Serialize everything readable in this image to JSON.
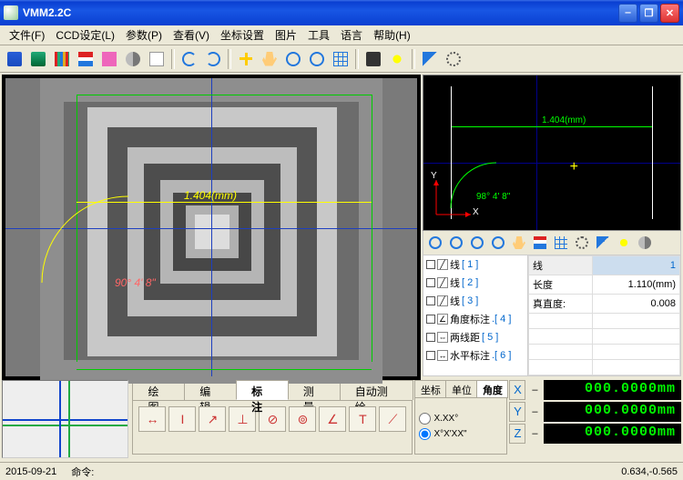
{
  "title": "VMM2.2C",
  "menu": [
    "文件(F)",
    "CCD设定(L)",
    "参数(P)",
    "查看(V)",
    "坐标设置",
    "图片",
    "工具",
    "语言",
    "帮助(H)"
  ],
  "tool_icons": [
    "word",
    "excel",
    "chart",
    "bar",
    "pink",
    "cut",
    "a",
    "sep",
    "undo",
    "redo",
    "sep",
    "plus",
    "hand",
    "zoom",
    "zoom",
    "grid",
    "sep",
    "cam",
    "light",
    "sep",
    "arrow",
    "gear"
  ],
  "video": {
    "dim_label": "1.404(mm)",
    "angle_label": "90° 4' 8\""
  },
  "cad": {
    "dim_label": "1.404(mm)",
    "angle_label": "98° 4' 8\"",
    "axis_x": "X",
    "axis_y": "Y"
  },
  "objlist": [
    {
      "icon": "╱",
      "label": "线",
      "idx": "[ 1 ]"
    },
    {
      "icon": "╱",
      "label": "线",
      "idx": "[ 2 ]"
    },
    {
      "icon": "╱",
      "label": "线",
      "idx": "[ 3 ]"
    },
    {
      "icon": "∠",
      "label": "角度标注",
      "idx": ".[ 4 ]"
    },
    {
      "icon": "⇔",
      "label": "两线距",
      "idx": "[ 5 ]"
    },
    {
      "icon": "↔",
      "label": "水平标注",
      "idx": ".[ 6 ]"
    }
  ],
  "props": {
    "header_l": "线",
    "header_r": "1",
    "rows": [
      {
        "k": "长度",
        "v": "1.110(mm)"
      },
      {
        "k": "真直度:",
        "v": "0.008"
      }
    ]
  },
  "tabs": [
    "绘图",
    "编辑",
    "标注",
    "测量",
    "自动测绘"
  ],
  "active_tab": 2,
  "dim_buttons": [
    "↔",
    "I",
    "↗",
    "⊥",
    "⊘",
    "⊚",
    "∠",
    "T",
    "⟋"
  ],
  "coord_tabs": [
    "坐标",
    "单位",
    "角度"
  ],
  "coord_active": 2,
  "angle_opts": [
    "X.XX°",
    "X°X'XX\""
  ],
  "readouts": [
    {
      "axis": "X",
      "val": "000.0000mm"
    },
    {
      "axis": "Y",
      "val": "000.0000mm"
    },
    {
      "axis": "Z",
      "val": "000.0000mm"
    }
  ],
  "status": {
    "date": "2015-09-21",
    "cmd_label": "命令:",
    "coords": "0.634,-0.565"
  }
}
